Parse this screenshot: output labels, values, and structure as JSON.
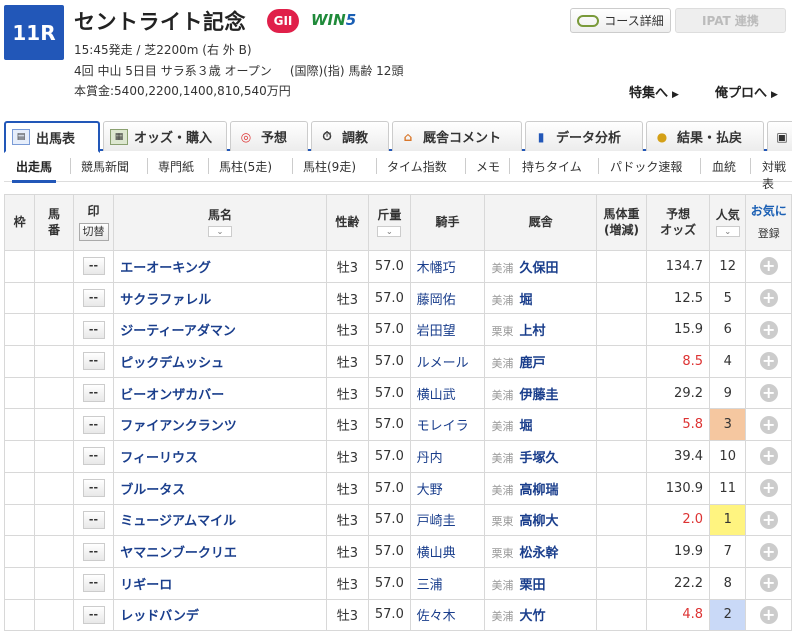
{
  "race": {
    "number": "11R",
    "name": "セントライト記念",
    "grade": "GII",
    "win5_prefix": "WIN",
    "win5_suffix": "5",
    "time_course": "15:45発走 / 芝2200m (右 外 B)",
    "meeting": "4回 中山 5日目 サラ系３歳 オープン",
    "conditions": "(国際)(指) 馬齢 12頭",
    "prize": "本賞金:5400,2200,1400,810,540万円"
  },
  "buttons": {
    "course": "コース詳細",
    "ipat": "IPAT 連携",
    "tokushu": "特集へ",
    "orepro": "俺プロへ"
  },
  "main_tabs": [
    "出馬表",
    "オッズ・購入",
    "予想",
    "調教",
    "厩舎コメント",
    "データ分析",
    "結果・払戻"
  ],
  "sub_tabs": [
    "出走馬",
    "競馬新聞",
    "専門紙",
    "馬柱(5走)",
    "馬柱(9走)",
    "タイム指数",
    "メモ",
    "持ちタイム",
    "パドック速報",
    "血統",
    "対戦表"
  ],
  "table": {
    "headers": {
      "waku": "枠",
      "uma_1": "馬",
      "uma_2": "番",
      "mark": "印",
      "kirikae": "切替",
      "name": "馬名",
      "sex": "性齢",
      "kin": "斤量",
      "jockey": "騎手",
      "trainer": "厩舎",
      "weight_1": "馬体重",
      "weight_2": "(増減)",
      "odds_1": "予想",
      "odds_2": "オッズ",
      "pop": "人気",
      "fav": "お気に",
      "reg": "登録"
    },
    "mark_default": "--",
    "rows": [
      {
        "name": "エーオーキング",
        "sex": "牡3",
        "kin": "57.0",
        "jockey": "木幡巧",
        "area": "美浦",
        "trainer": "久保田",
        "odds": "134.7",
        "pop": "12"
      },
      {
        "name": "サクラファレル",
        "sex": "牡3",
        "kin": "57.0",
        "jockey": "藤岡佑",
        "area": "美浦",
        "trainer": "堀",
        "odds": "12.5",
        "pop": "5"
      },
      {
        "name": "ジーティーアダマン",
        "sex": "牡3",
        "kin": "57.0",
        "jockey": "岩田望",
        "area": "栗東",
        "trainer": "上村",
        "odds": "15.9",
        "pop": "6"
      },
      {
        "name": "ピックデムッシュ",
        "sex": "牡3",
        "kin": "57.0",
        "jockey": "ルメール",
        "area": "美浦",
        "trainer": "鹿戸",
        "odds": "8.5",
        "pop": "4"
      },
      {
        "name": "ビーオンザカバー",
        "sex": "牡3",
        "kin": "57.0",
        "jockey": "横山武",
        "area": "美浦",
        "trainer": "伊藤圭",
        "odds": "29.2",
        "pop": "9"
      },
      {
        "name": "ファイアンクランツ",
        "sex": "牡3",
        "kin": "57.0",
        "jockey": "モレイラ",
        "area": "美浦",
        "trainer": "堀",
        "odds": "5.8",
        "pop": "3"
      },
      {
        "name": "フィーリウス",
        "sex": "牡3",
        "kin": "57.0",
        "jockey": "丹内",
        "area": "美浦",
        "trainer": "手塚久",
        "odds": "39.4",
        "pop": "10"
      },
      {
        "name": "ブルータス",
        "sex": "牡3",
        "kin": "57.0",
        "jockey": "大野",
        "area": "美浦",
        "trainer": "高柳瑞",
        "odds": "130.9",
        "pop": "11"
      },
      {
        "name": "ミュージアムマイル",
        "sex": "牡3",
        "kin": "57.0",
        "jockey": "戸崎圭",
        "area": "栗東",
        "trainer": "高柳大",
        "odds": "2.0",
        "pop": "1"
      },
      {
        "name": "ヤマニンブークリエ",
        "sex": "牡3",
        "kin": "57.0",
        "jockey": "横山典",
        "area": "栗東",
        "trainer": "松永幹",
        "odds": "19.9",
        "pop": "7"
      },
      {
        "name": "リギーロ",
        "sex": "牡3",
        "kin": "57.0",
        "jockey": "三浦",
        "area": "美浦",
        "trainer": "栗田",
        "odds": "22.2",
        "pop": "8"
      },
      {
        "name": "レッドバンデ",
        "sex": "牡3",
        "kin": "57.0",
        "jockey": "佐々木",
        "area": "美浦",
        "trainer": "大竹",
        "odds": "4.8",
        "pop": "2"
      }
    ]
  },
  "colors": {
    "accent": "#2257b8",
    "pop1": "#fff480",
    "pop2": "#c9d9f7",
    "pop3": "#f5c7a0",
    "odds_hot": "#d33"
  }
}
